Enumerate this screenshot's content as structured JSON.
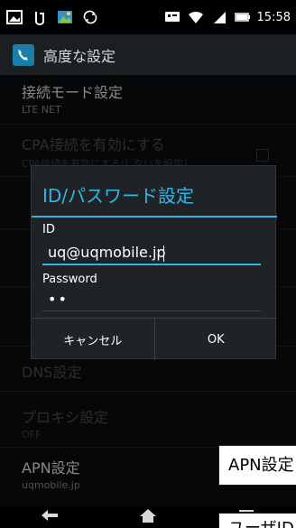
{
  "status_bar": {
    "time": "15:58",
    "left_icons": [
      "screenshot-icon",
      "data-usage-icon",
      "gallery-icon",
      "sync-icon"
    ],
    "right_icons": [
      "notification-icon",
      "wifi-icon",
      "signal-icon",
      "battery-icon"
    ]
  },
  "action_bar": {
    "title": "高度な設定"
  },
  "settings": {
    "connection_mode": {
      "title": "接続モード設定",
      "subtitle": "LTE NET"
    },
    "cpa": {
      "title": "CPA接続を有効にする",
      "subtitle": "CPA接続を有効にする/しないを設定し"
    },
    "dns": {
      "title": "DNS設定"
    },
    "proxy": {
      "title": "プロキシ設定",
      "subtitle": "OFF"
    },
    "apn": {
      "title": "APN設定",
      "subtitle": "uqmobile.jp"
    }
  },
  "dialog": {
    "title": "ID/パスワード設定",
    "id_label": "ID",
    "id_value": "uq@uqmobile.jp",
    "password_label": "Password",
    "password_value": "••",
    "cancel_label": "キャンセル",
    "ok_label": "OK"
  },
  "annotations": {
    "apn": "APN設定",
    "user": "ユーザID"
  },
  "accent_color": "#33b5e5"
}
